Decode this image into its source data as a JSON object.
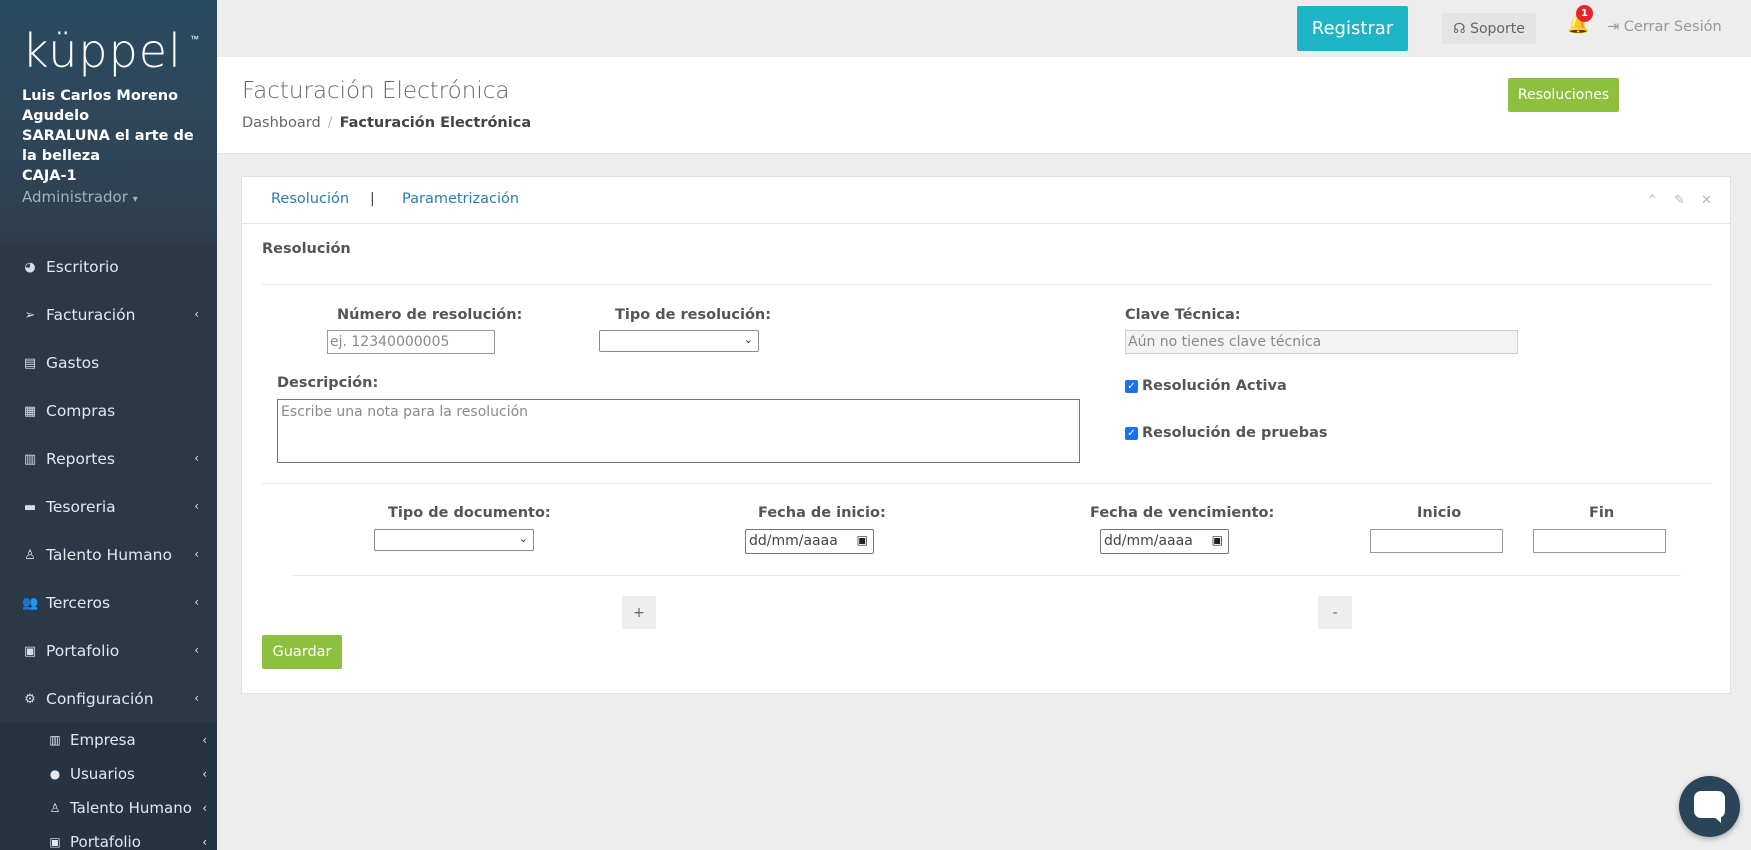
{
  "app": {
    "logo_text": "küppel",
    "logo_tm": "™"
  },
  "profile": {
    "name_line1": "Luis Carlos Moreno",
    "name_line2": "Agudelo",
    "company_line1": "SARALUNA el arte de",
    "company_line2": "la belleza",
    "register": "CAJA-1",
    "role": "Administrador",
    "role_caret": "▾"
  },
  "sidebar": {
    "items": [
      {
        "label": "Escritorio",
        "icon": "dashboard-icon",
        "glyph": "◕"
      },
      {
        "label": "Facturación",
        "icon": "paper-plane-icon",
        "glyph": "➢",
        "chevron": "‹"
      },
      {
        "label": "Gastos",
        "icon": "file-icon",
        "glyph": "▤"
      },
      {
        "label": "Compras",
        "icon": "boxes-icon",
        "glyph": "▦"
      },
      {
        "label": "Reportes",
        "icon": "bar-chart-icon",
        "glyph": "▥",
        "chevron": "‹"
      },
      {
        "label": "Tesoreria",
        "icon": "wallet-icon",
        "glyph": "▬",
        "chevron": "‹"
      },
      {
        "label": "Talento Humano",
        "icon": "person-icon",
        "glyph": "♙",
        "chevron": "‹"
      },
      {
        "label": "Terceros",
        "icon": "users-icon",
        "glyph": "👥",
        "chevron": "‹"
      },
      {
        "label": "Portafolio",
        "icon": "briefcase-icon",
        "glyph": "▣",
        "chevron": "‹"
      },
      {
        "label": "Configuración",
        "icon": "gear-icon",
        "glyph": "⚙",
        "chevron": "‹"
      }
    ],
    "subitems": [
      {
        "label": "Empresa",
        "icon": "building-icon",
        "glyph": "▥",
        "chevron": "‹"
      },
      {
        "label": "Usuarios",
        "icon": "user-icon",
        "glyph": "●",
        "chevron": "‹"
      },
      {
        "label": "Talento Humano",
        "icon": "person-icon",
        "glyph": "♙",
        "chevron": "‹"
      },
      {
        "label": "Portafolio",
        "icon": "briefcase-icon",
        "glyph": "▣",
        "chevron": "‹"
      }
    ]
  },
  "topbar": {
    "register_label": "Registrar",
    "support_label": "Soporte",
    "support_glyph": "☊",
    "bell_glyph": "🔔",
    "notifications_count": "1",
    "logout_glyph": "⇥",
    "logout_label": "Cerrar Sesión"
  },
  "page": {
    "title": "Facturación Electrónica",
    "breadcrumb_home": "Dashboard",
    "breadcrumb_sep": "/",
    "breadcrumb_current": "Facturación Electrónica",
    "resoluciones_label": "Resoluciones"
  },
  "panel": {
    "tabs": [
      "Resolución",
      "Parametrización"
    ],
    "tab_separator": "|",
    "tools": "⌃ ✎ ✕",
    "section_title": "Resolución"
  },
  "form": {
    "numero_label": "Número de resolución:",
    "numero_placeholder": "ej. 12340000005",
    "tipo_label": "Tipo de resolución:",
    "clave_label": "Clave Técnica:",
    "clave_placeholder": "Aún no tienes clave técnica",
    "descripcion_label": "Descripción:",
    "descripcion_placeholder": "Escribe una nota para la resolución",
    "activa_label": "Resolución Activa",
    "activa_checked": true,
    "pruebas_label": "Resolución de pruebas",
    "pruebas_checked": true,
    "tipo_doc_label": "Tipo de documento:",
    "fecha_inicio_label": "Fecha de inicio:",
    "fecha_inicio_placeholder": "dd/mm/aaaa",
    "fecha_venc_label": "Fecha de vencimiento:",
    "fecha_venc_placeholder": "dd/mm/aaaa",
    "inicio_label": "Inicio",
    "fin_label": "Fin",
    "add_label": "+",
    "remove_label": "-",
    "save_label": "Guardar",
    "select_arrow": "⌄",
    "calendar_glyph": "▣",
    "check_glyph": "✓"
  }
}
